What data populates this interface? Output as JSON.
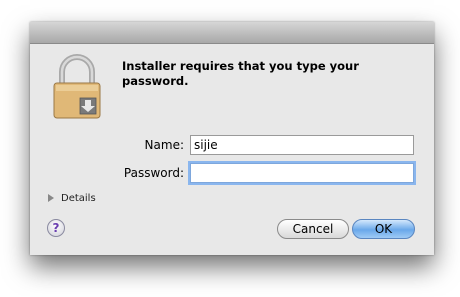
{
  "dialog": {
    "message": "Installer requires that you type your password.",
    "name_label": "Name:",
    "name_value": "sijie",
    "password_label": "Password:",
    "password_value": "",
    "details_label": "Details",
    "help_label": "?",
    "cancel_label": "Cancel",
    "ok_label": "OK"
  },
  "icons": {
    "lock": "lock-icon",
    "details_toggle": "disclosure-triangle-icon",
    "help": "help-icon"
  },
  "colors": {
    "ok_button": "#6aa8ea",
    "focus_ring": "#8ab6ee",
    "dialog_background": "#e8e8e8"
  }
}
